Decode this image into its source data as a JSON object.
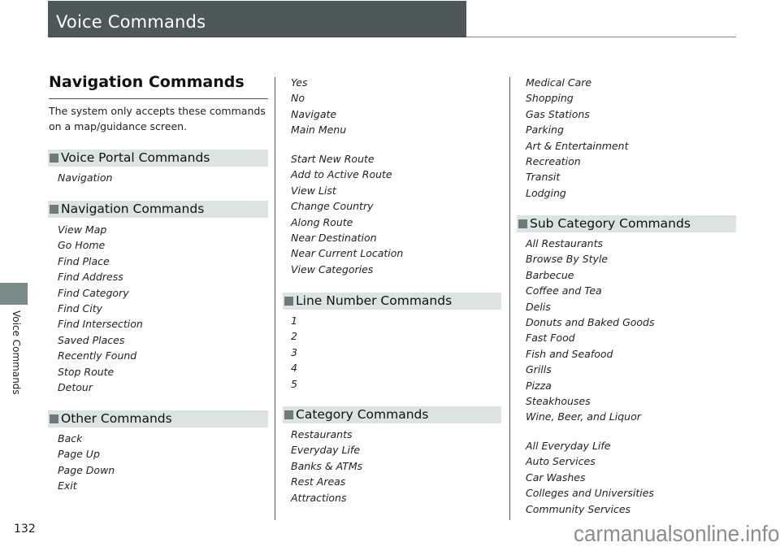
{
  "header": {
    "title": "Voice Commands"
  },
  "sidebar": {
    "tab_label": "Voice Commands"
  },
  "footer": {
    "page_number": "132",
    "watermark": "carmanualsonline.info"
  },
  "column1": {
    "heading": "Navigation Commands",
    "intro": "The system only accepts these commands on a map/guidance screen.",
    "sections": [
      {
        "title": "Voice Portal Commands",
        "items": [
          "Navigation"
        ]
      },
      {
        "title": "Navigation Commands",
        "items": [
          "View Map",
          "Go Home",
          "Find Place",
          "Find Address",
          "Find Category",
          "Find City",
          "Find Intersection",
          "Saved Places",
          "Recently Found",
          "Stop Route",
          "Detour"
        ]
      },
      {
        "title": "Other Commands",
        "items": [
          "Back",
          "Page Up",
          "Page Down",
          "Exit"
        ]
      }
    ]
  },
  "column2": {
    "list_a": [
      "Yes",
      "No",
      "Navigate",
      "Main Menu"
    ],
    "list_b": [
      "Start New Route",
      "Add to Active Route",
      "View List",
      "Change Country",
      "Along Route",
      "Near Destination",
      "Near Current Location",
      "View Categories"
    ],
    "sections": [
      {
        "title": "Line Number Commands",
        "items": [
          "1",
          "2",
          "3",
          "4",
          "5"
        ]
      },
      {
        "title": "Category Commands",
        "items": [
          "Restaurants",
          "Everyday Life",
          "Banks & ATMs",
          "Rest Areas",
          "Attractions"
        ]
      }
    ]
  },
  "column3": {
    "list_a": [
      "Medical Care",
      "Shopping",
      "Gas Stations",
      "Parking",
      "Art & Entertainment",
      "Recreation",
      "Transit",
      "Lodging"
    ],
    "sections": [
      {
        "title": "Sub Category Commands",
        "items": [
          "All Restaurants",
          "Browse By Style",
          "Barbecue",
          "Coffee and Tea",
          "Delis",
          "Donuts and Baked Goods",
          "Fast Food",
          "Fish and Seafood",
          "Grills",
          "Pizza",
          "Steakhouses",
          "Wine, Beer, and Liquor"
        ],
        "items_b": [
          "All Everyday Life",
          "Auto Services",
          "Car Washes",
          "Colleges and Universities",
          "Community Services"
        ]
      }
    ]
  },
  "colors": {
    "header_bg": "#4c5859",
    "section_bg": "#dde2e2",
    "section_marker": "#6f7b7b",
    "side_tab": "#7b8a8a"
  }
}
